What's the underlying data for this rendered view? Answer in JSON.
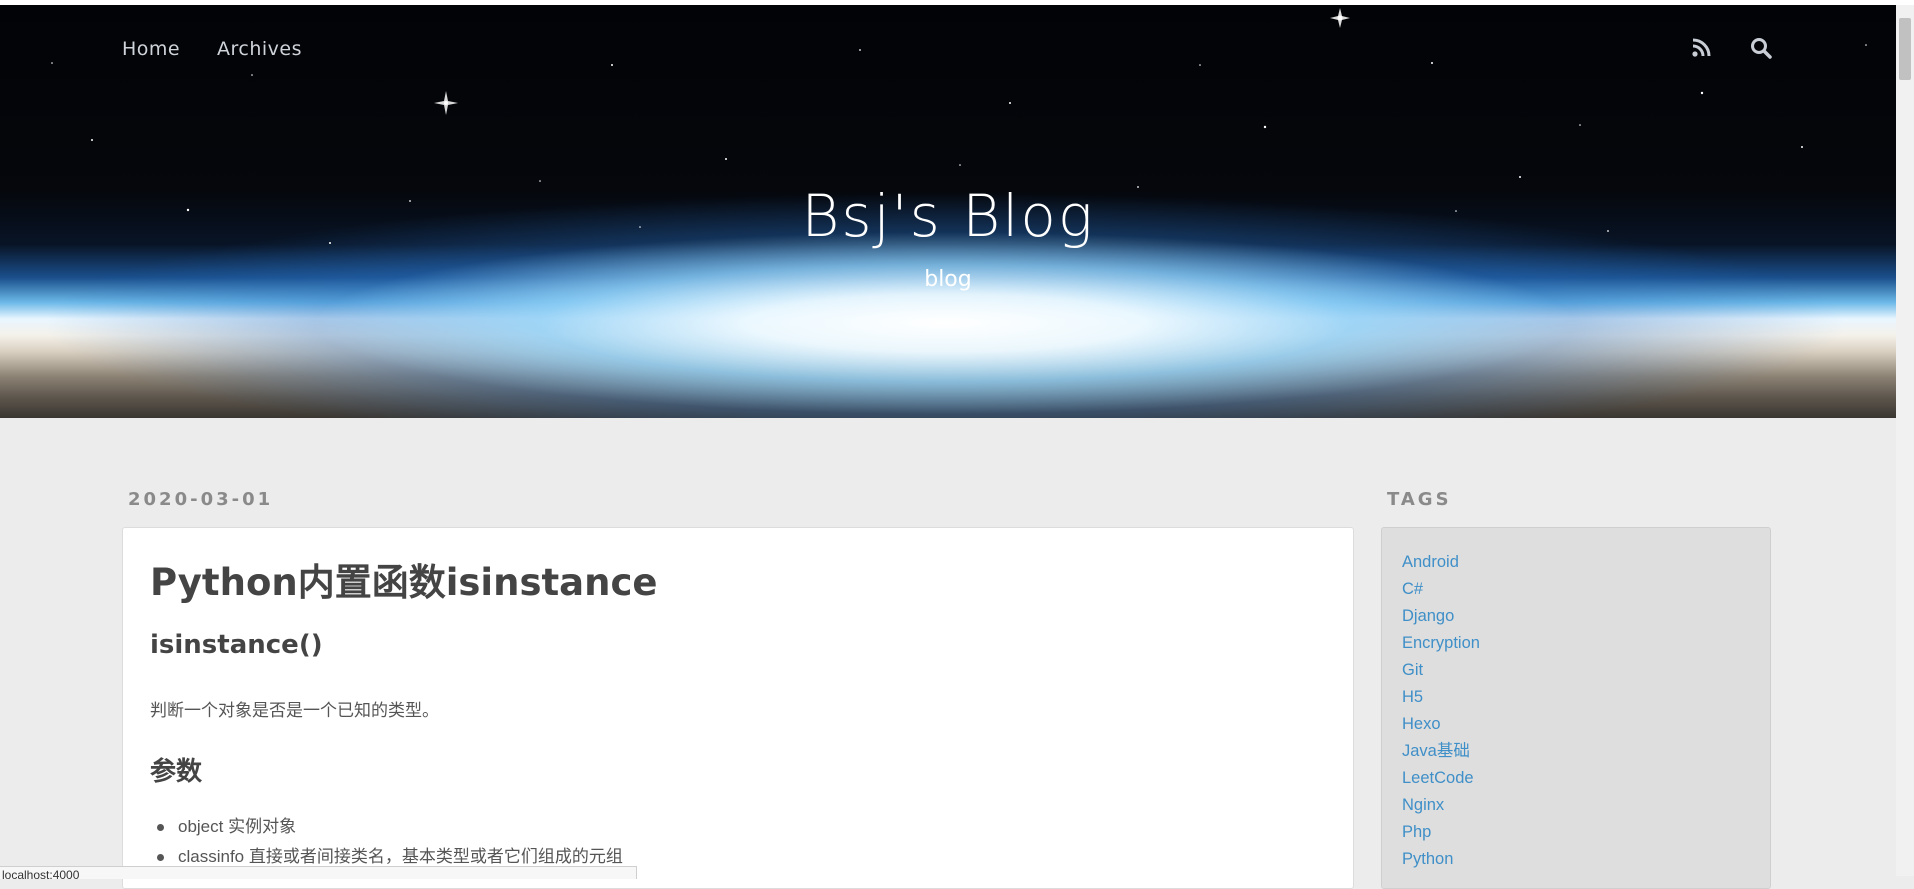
{
  "nav": {
    "home": "Home",
    "archives": "Archives",
    "rss_icon": "rss-icon",
    "search_icon": "search-icon"
  },
  "header": {
    "title": "Bsj's Blog",
    "subtitle": "blog"
  },
  "post": {
    "date": "2020-03-01",
    "title": "Python内置函数isinstance",
    "heading_1": "isinstance()",
    "description": "判断一个对象是否是一个已知的类型。",
    "heading_2": "参数",
    "params": [
      "object 实例对象",
      "classinfo 直接或者间接类名，基本类型或者它们组成的元组"
    ]
  },
  "sidebar": {
    "tags_heading": "TAGS",
    "tags": [
      "Android",
      "C#",
      "Django",
      "Encryption",
      "Git",
      "H5",
      "Hexo",
      "Java基础",
      "LeetCode",
      "Nginx",
      "Php",
      "Python"
    ]
  },
  "status_bar": {
    "url": "localhost:4000"
  },
  "colors": {
    "link": "#3f8fc8",
    "page_background": "#ececec",
    "text": "#444444"
  }
}
